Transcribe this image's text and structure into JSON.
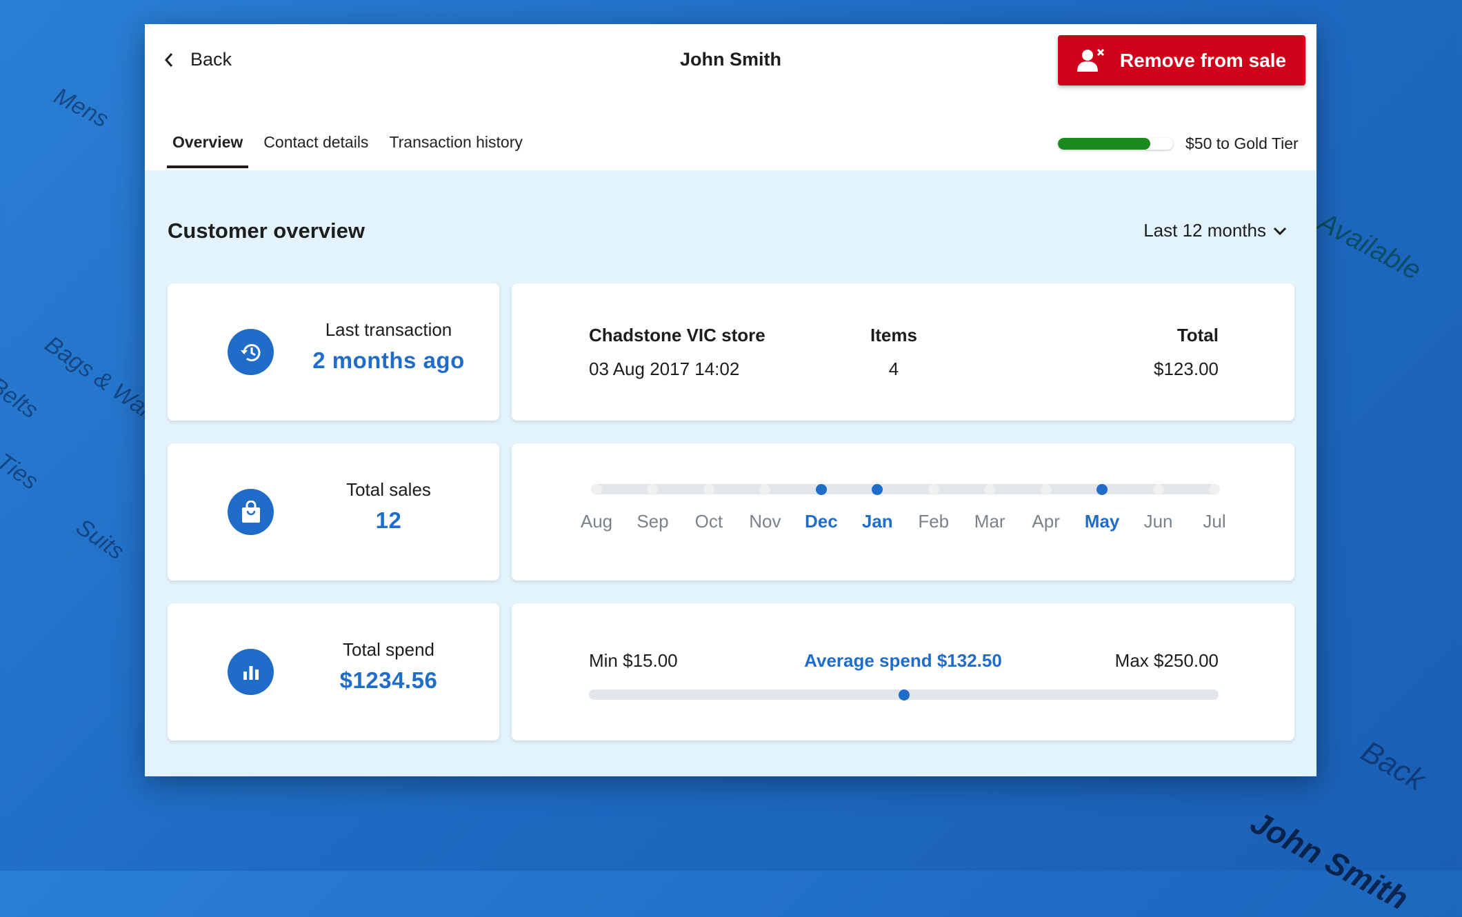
{
  "background_text": [
    "Mens",
    "Bags & Wallets",
    "Belts",
    "Ties",
    "Suits",
    "Available",
    "Back",
    "John Smith"
  ],
  "header": {
    "back_label": "Back",
    "title": "John Smith",
    "remove_button": "Remove from sale"
  },
  "tabs": [
    {
      "label": "Overview",
      "active": true
    },
    {
      "label": "Contact details",
      "active": false
    },
    {
      "label": "Transaction history",
      "active": false
    }
  ],
  "tier": {
    "label": "$50 to Gold Tier",
    "progress_percent": 80,
    "color": "#1a8a1f"
  },
  "overview": {
    "title": "Customer overview",
    "range": "Last 12 months"
  },
  "last_transaction": {
    "label": "Last transaction",
    "value": "2 months ago",
    "store": "Chadstone VIC store",
    "datetime": "03 Aug 2017 14:02",
    "items_label": "Items",
    "items": "4",
    "total_label": "Total",
    "total": "$123.00"
  },
  "total_sales": {
    "label": "Total sales",
    "value": "12",
    "months": [
      {
        "m": "Aug",
        "on": false
      },
      {
        "m": "Sep",
        "on": false
      },
      {
        "m": "Oct",
        "on": false
      },
      {
        "m": "Nov",
        "on": false
      },
      {
        "m": "Dec",
        "on": true
      },
      {
        "m": "Jan",
        "on": true
      },
      {
        "m": "Feb",
        "on": false
      },
      {
        "m": "Mar",
        "on": false
      },
      {
        "m": "Apr",
        "on": false
      },
      {
        "m": "May",
        "on": true
      },
      {
        "m": "Jun",
        "on": false
      },
      {
        "m": "Jul",
        "on": false
      }
    ]
  },
  "total_spend": {
    "label": "Total spend",
    "value": "$1234.56",
    "min": "Min $15.00",
    "average": "Average spend $132.50",
    "max": "Max $250.00",
    "min_value": 15,
    "avg_value": 132.5,
    "max_value": 250
  },
  "colors": {
    "accent": "#1f6dc9",
    "danger": "#d0021b",
    "panel_bg": "#e3f3fc"
  }
}
